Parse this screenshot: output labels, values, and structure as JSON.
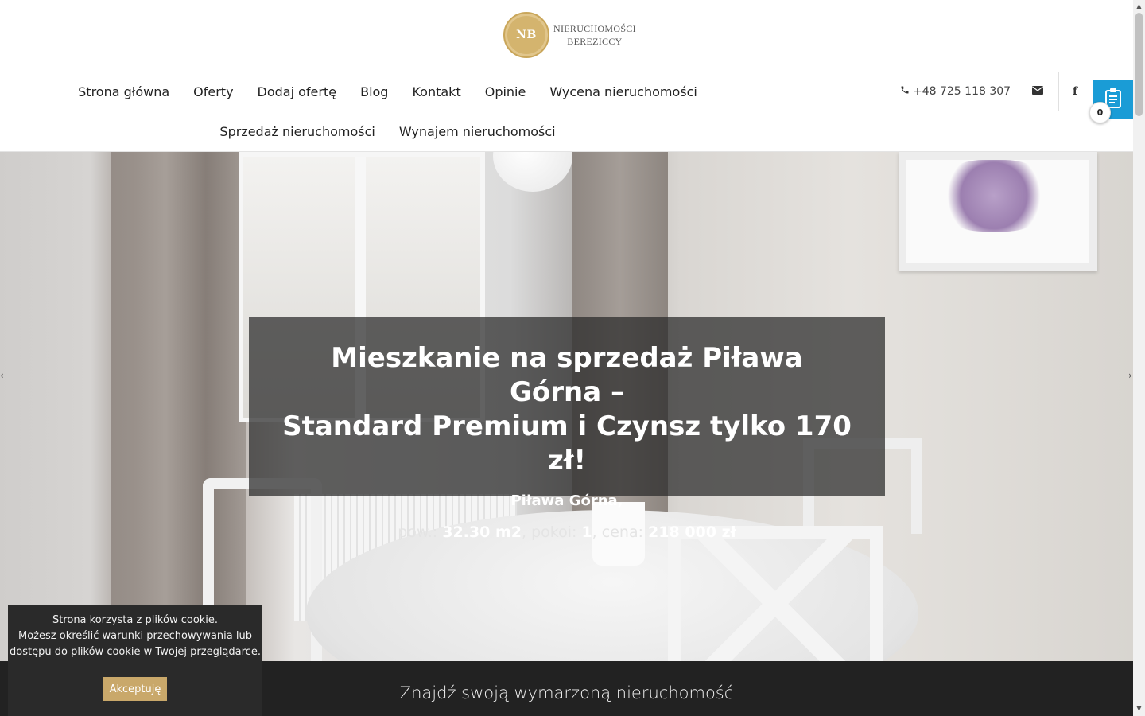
{
  "logo": {
    "initials": "NB",
    "line1": "NIERUCHOMOŚCI",
    "line2": "BEREZICCY"
  },
  "nav": {
    "row1": [
      "Strona główna",
      "Oferty",
      "Dodaj ofertę",
      "Blog",
      "Kontakt",
      "Opinie",
      "Wycena nieruchomości"
    ],
    "row2": [
      "Sprzedaż nieruchomości",
      "Wynajem nieruchomości"
    ]
  },
  "contact": {
    "phone": "+48 725 118 307",
    "phone_icon": "phone-icon",
    "mail_icon": "envelope-icon",
    "social_icon": "facebook-icon",
    "fb_glyph": "f"
  },
  "clipboard": {
    "count": "0",
    "icon": "clipboard-icon",
    "color": "#1a9cd6"
  },
  "hero": {
    "title_line1": "Mieszkanie na sprzedaż Piława Górna –",
    "title_line2": "Standard Premium i Czynsz tylko 170 zł!",
    "location": "Piława Górna,",
    "area_label": "pow.:",
    "area_value": "32.30 m2",
    "rooms_label": "pokoi:",
    "rooms_value": "1",
    "price_label": "cena:",
    "price_value": "218 000 zł",
    "prev_arrow": "‹",
    "next_arrow": "›"
  },
  "search": {
    "title": "Znajdź swoją wymarzoną nieruchomość"
  },
  "cookie": {
    "line1": "Strona korzysta z plików cookie.",
    "line2": "Możesz określić warunki przechowywania lub",
    "line3": "dostępu do plików cookie w Twojej przeglądarce.",
    "accept": "Akceptuję",
    "accept_color": "#c9a86a"
  },
  "scrollbar": {
    "up": "▲",
    "down": "▼"
  }
}
